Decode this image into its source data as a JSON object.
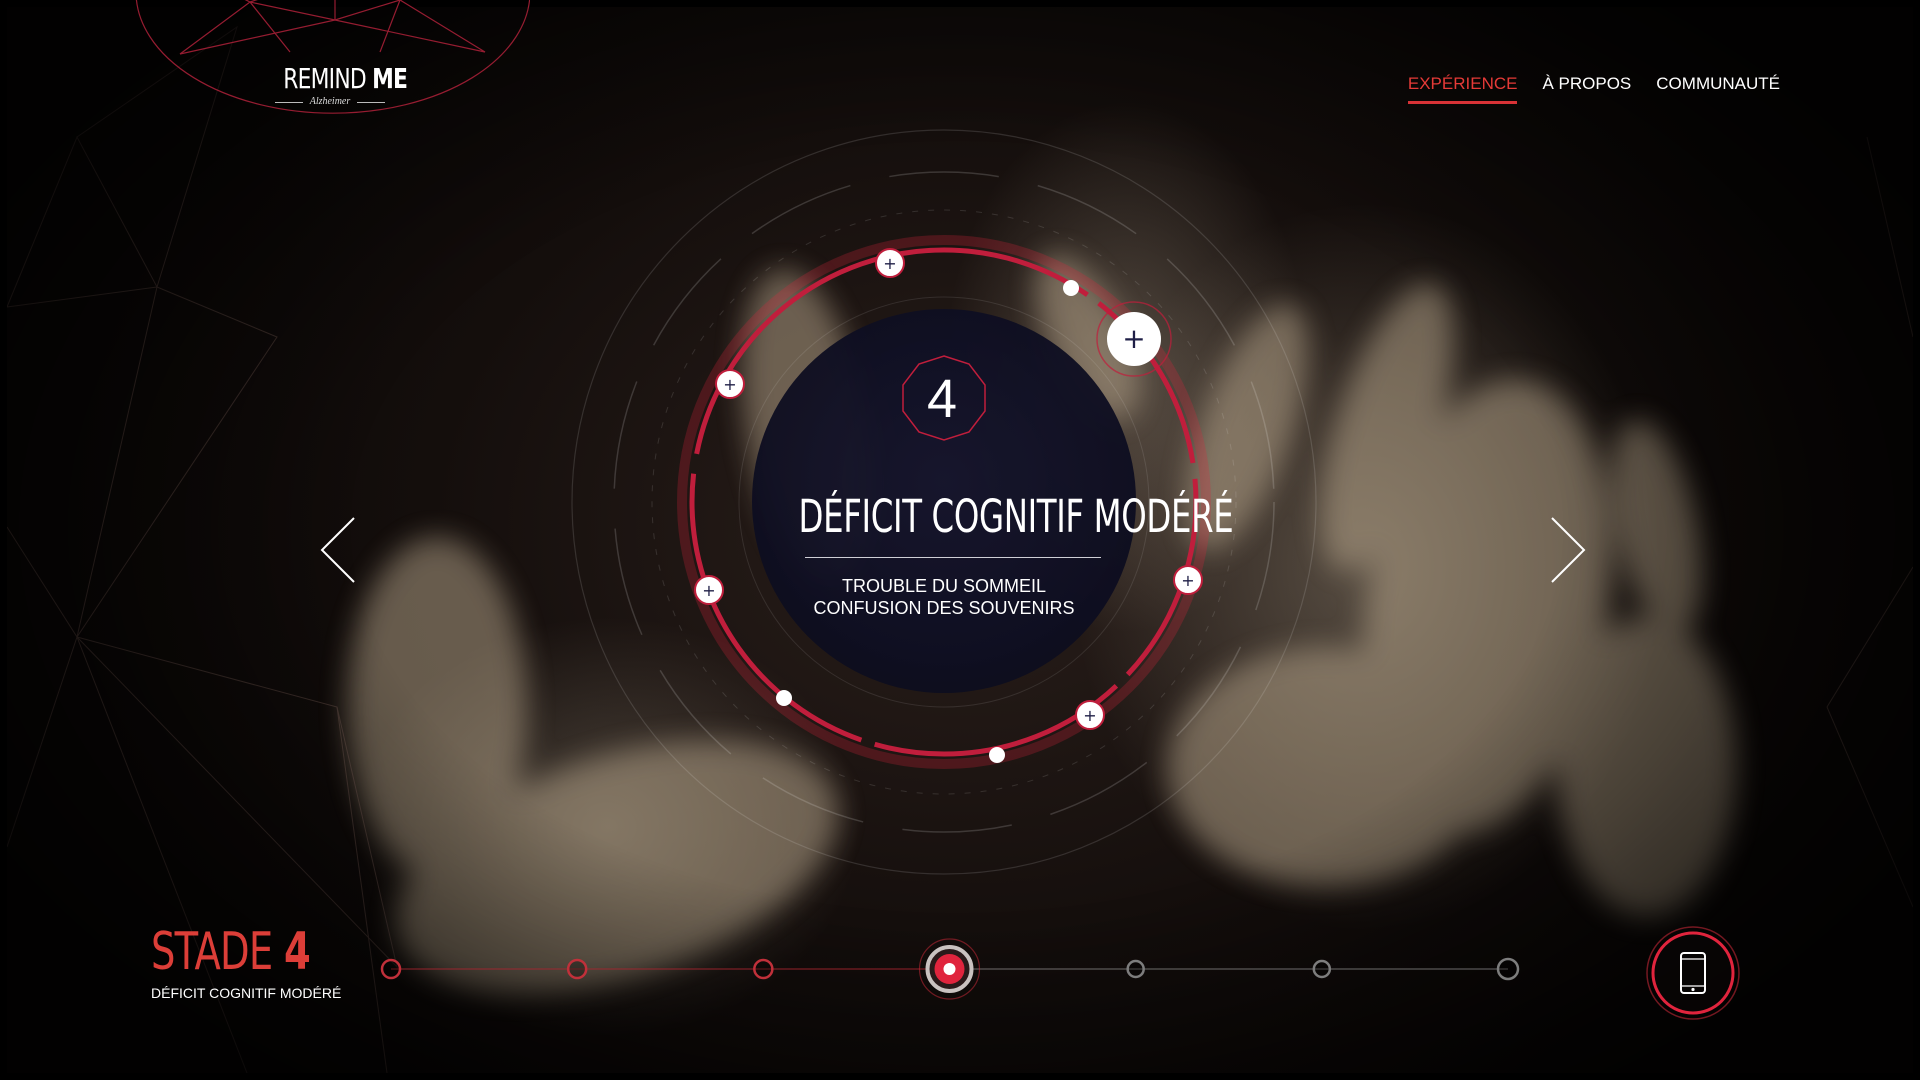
{
  "logo": {
    "title_light": "REMIND",
    "title_bold": "ME",
    "subtitle": "Alzheimer"
  },
  "nav": {
    "items": [
      {
        "label": "EXPÉRIENCE",
        "active": true
      },
      {
        "label": "À PROPOS",
        "active": false
      },
      {
        "label": "COMMUNAUTÉ",
        "active": false
      }
    ]
  },
  "stage": {
    "number": "4",
    "title": "DÉFICIT COGNITIF MODÉRÉ",
    "symptoms": [
      "TROUBLE DU SOMMEIL",
      "CONFUSION DES SOUVENIRS"
    ]
  },
  "bottom": {
    "stage_label_prefix": "STADE",
    "stage_label_number": "4",
    "stage_caption": "DÉFICIT COGNITIF MODÉRÉ"
  },
  "timeline": {
    "total_stages": 7,
    "current_stage": 4
  },
  "colors": {
    "accent": "#e0243d",
    "accent_text": "#dc3e38",
    "nav_active": "#e53a37",
    "ring": "#c01e3c",
    "disc": "#16162e",
    "plus_icon": "#1e1e46"
  },
  "icons": {
    "prev": "chevron-left-icon",
    "next": "chevron-right-icon",
    "hotspot": "plus-icon",
    "mobile": "smartphone-icon"
  }
}
